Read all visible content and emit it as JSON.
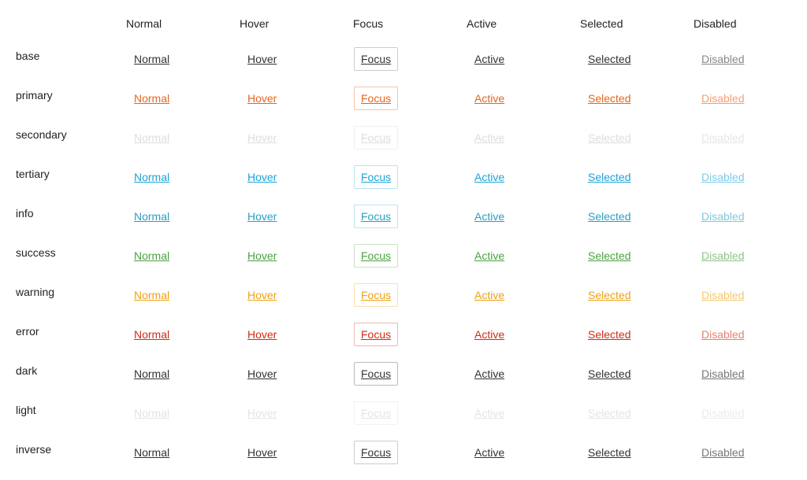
{
  "columns": [
    "Normal",
    "Hover",
    "Focus",
    "Active",
    "Selected",
    "Disabled"
  ],
  "rows": [
    {
      "name": "base",
      "colors": [
        "#333333",
        "#333333",
        "#333333",
        "#333333",
        "#333333",
        "#888888"
      ],
      "focus_border": "#cccccc"
    },
    {
      "name": "primary",
      "colors": [
        "#e8651a",
        "#e8651a",
        "#e8651a",
        "#e8651a",
        "#e8651a",
        "#f2a070"
      ],
      "focus_border": "#f7c4a8"
    },
    {
      "name": "secondary",
      "colors": [
        "#dddddd",
        "#dddddd",
        "#dddddd",
        "#dddddd",
        "#dddddd",
        "#e6e6e6"
      ],
      "focus_border": "#f0f0f0"
    },
    {
      "name": "tertiary",
      "colors": [
        "#1aa3d9",
        "#1aa3d9",
        "#1aa3d9",
        "#1aa3d9",
        "#1aa3d9",
        "#7ccbe8"
      ],
      "focus_border": "#b8e3f2"
    },
    {
      "name": "info",
      "colors": [
        "#2a9fc2",
        "#2a9fc2",
        "#2a9fc2",
        "#2a9fc2",
        "#2a9fc2",
        "#80c8dc"
      ],
      "focus_border": "#bfe2ec"
    },
    {
      "name": "success",
      "colors": [
        "#4aa040",
        "#4aa040",
        "#4aa040",
        "#4aa040",
        "#4aa040",
        "#8fc489"
      ],
      "focus_border": "#c6e2c2"
    },
    {
      "name": "warning",
      "colors": [
        "#f0a010",
        "#f0a010",
        "#f0a010",
        "#f0a010",
        "#f0a010",
        "#f5c870"
      ],
      "focus_border": "#fae0b0"
    },
    {
      "name": "error",
      "colors": [
        "#d42a14",
        "#d42a14",
        "#d42a14",
        "#d42a14",
        "#d42a14",
        "#e5826f"
      ],
      "focus_border": "#f0b8ae"
    },
    {
      "name": "dark",
      "colors": [
        "#333333",
        "#333333",
        "#333333",
        "#333333",
        "#333333",
        "#777777"
      ],
      "focus_border": "#bbbbbb"
    },
    {
      "name": "light",
      "colors": [
        "#e4e4e4",
        "#e4e4e4",
        "#e4e4e4",
        "#e4e4e4",
        "#e4e4e4",
        "#ececec"
      ],
      "focus_border": "#f2f2f2"
    },
    {
      "name": "inverse",
      "colors": [
        "#333333",
        "#333333",
        "#333333",
        "#333333",
        "#333333",
        "#777777"
      ],
      "focus_border": "#cccccc"
    }
  ]
}
